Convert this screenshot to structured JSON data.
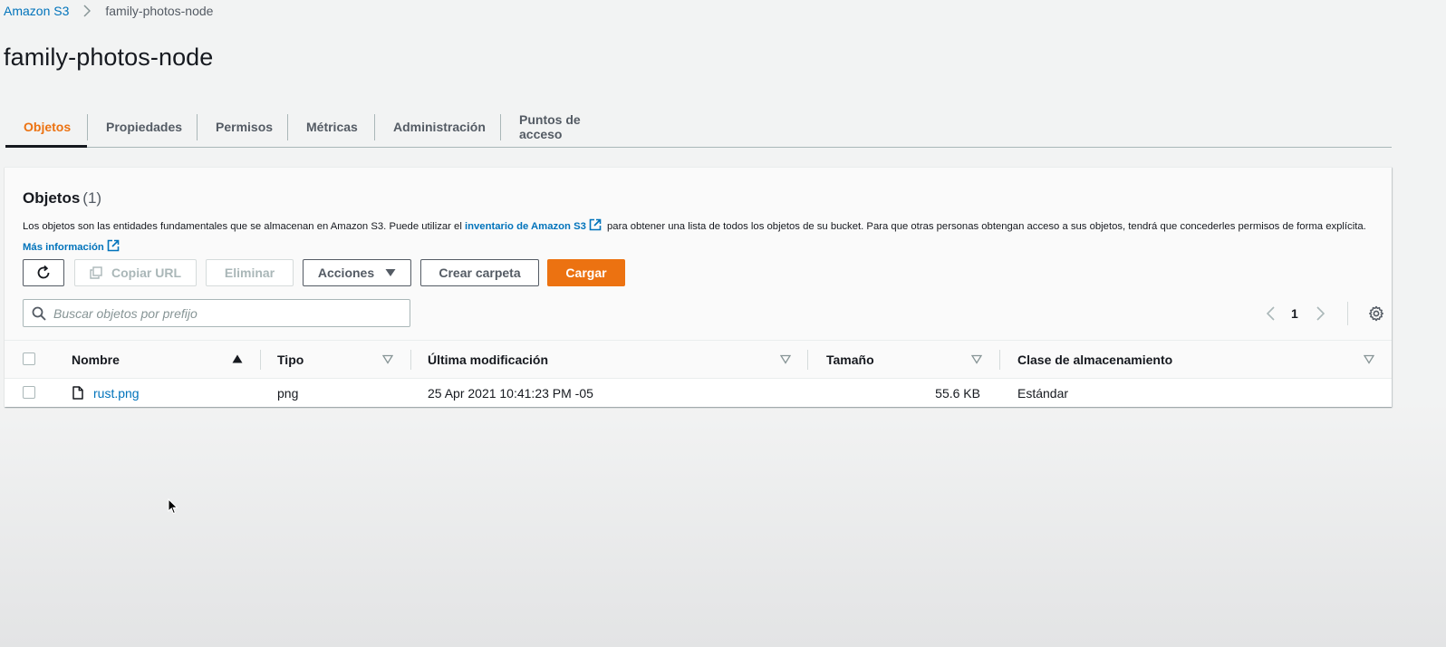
{
  "breadcrumb": {
    "root": "Amazon S3",
    "current": "family-photos-node"
  },
  "page": {
    "title": "family-photos-node"
  },
  "tabs": [
    {
      "label": "Objetos",
      "active": true
    },
    {
      "label": "Propiedades",
      "active": false
    },
    {
      "label": "Permisos",
      "active": false
    },
    {
      "label": "Métricas",
      "active": false
    },
    {
      "label": "Administración",
      "active": false
    },
    {
      "label": "Puntos de acceso",
      "active": false
    }
  ],
  "objects_panel": {
    "title": "Objetos",
    "count": "(1)",
    "desc_part1": "Los objetos son las entidades fundamentales que se almacenan en Amazon S3. Puede utilizar el ",
    "desc_link1": "inventario de Amazon S3",
    "desc_part2": " para obtener una lista de todos los objetos de su bucket. Para que otras personas obtengan acceso a sus objetos, tendrá que concederles permisos de forma explícita. ",
    "desc_link2": "Más información"
  },
  "toolbar": {
    "refresh_icon": "refresh-icon",
    "copy_url_label": "Copiar URL",
    "delete_label": "Eliminar",
    "actions_label": "Acciones",
    "create_folder_label": "Crear carpeta",
    "upload_label": "Cargar"
  },
  "search": {
    "placeholder": "Buscar objetos por prefijo",
    "value": ""
  },
  "pagination": {
    "current_page": "1"
  },
  "table": {
    "columns": [
      "Nombre",
      "Tipo",
      "Última modificación",
      "Tamaño",
      "Clase de almacenamiento"
    ],
    "rows": [
      {
        "name": "rust.png",
        "type": "png",
        "modified": "25 Apr 2021 10:41:23 PM -05",
        "size": "55.6 KB",
        "storage_class": "Estándar"
      }
    ]
  },
  "colors": {
    "accent": "#ec7211",
    "link": "#0073bb",
    "text": "#16191f",
    "muted": "#545b64"
  }
}
